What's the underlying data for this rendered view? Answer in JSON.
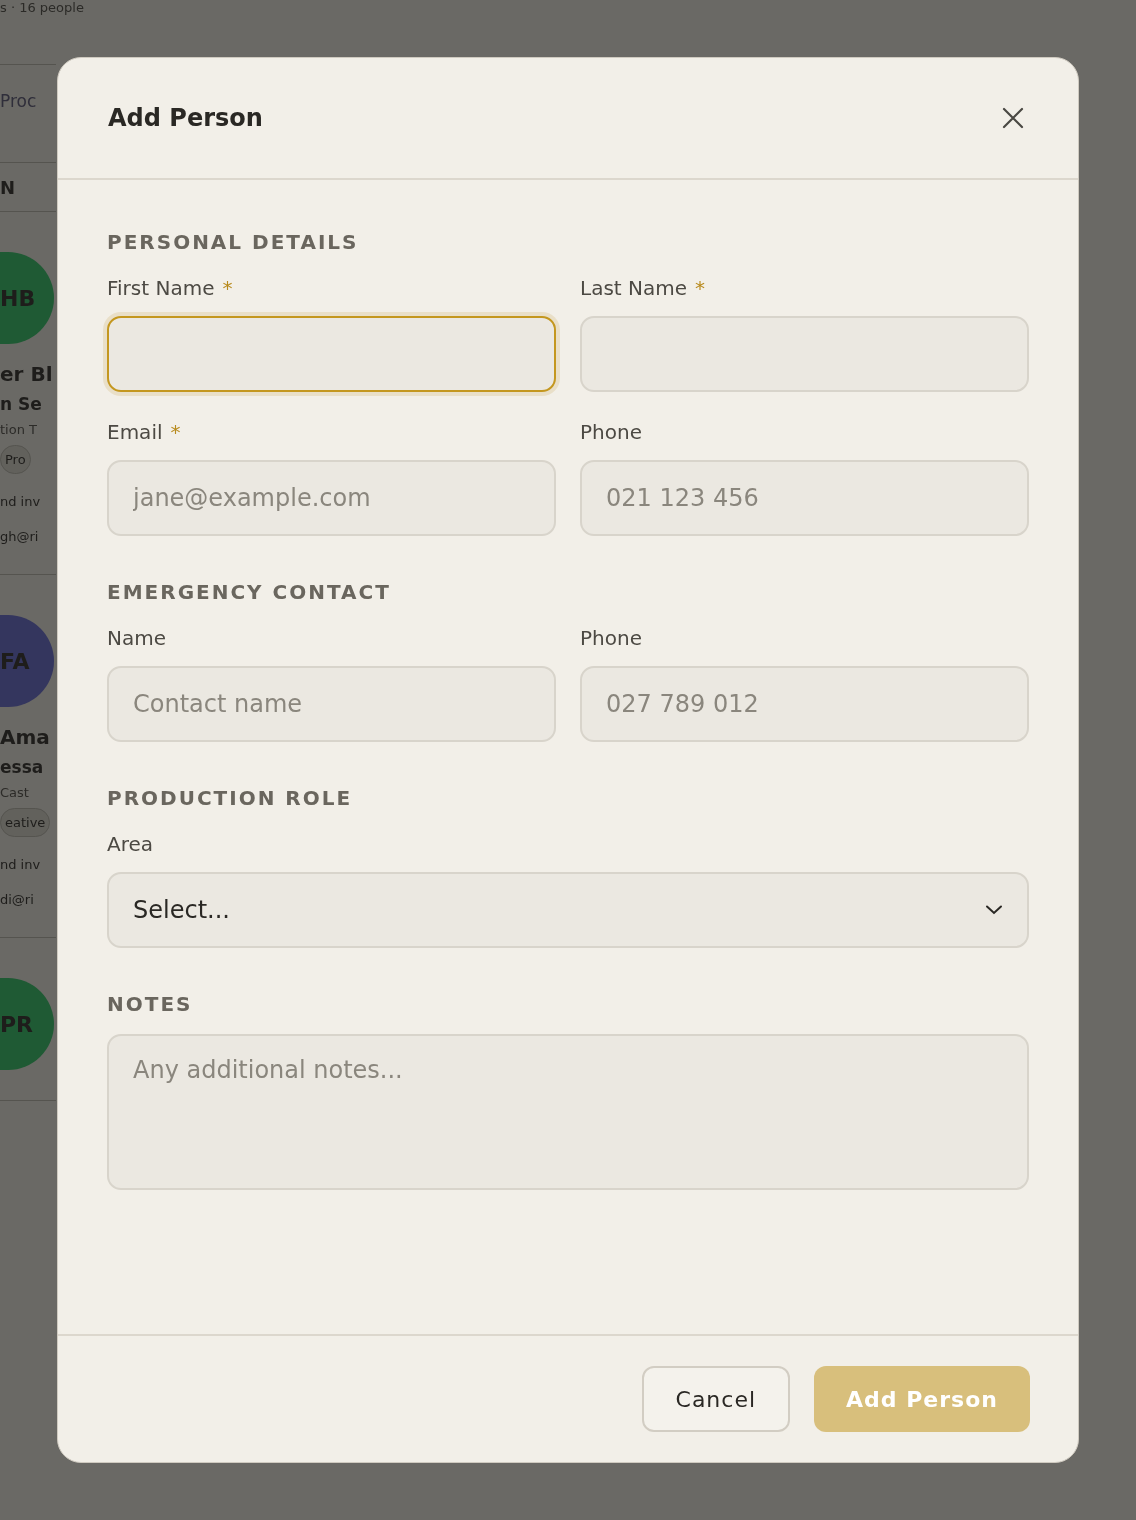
{
  "background": {
    "header_text": "s · 16 people",
    "tab_text": "Proc",
    "column_text": "N",
    "cards": [
      {
        "initials": "HB",
        "color": "#1f5a34",
        "name": "er Bl",
        "role": "n Se",
        "team": "tion T",
        "tag": "Pro",
        "status": "nd inv",
        "email": "gh@ri"
      },
      {
        "initials": "FA",
        "color": "#34365e",
        "name": "Ama",
        "role": "essa",
        "team": "Cast",
        "tag": "eative",
        "status": "nd inv",
        "email": "di@ri"
      },
      {
        "initials": "PR",
        "color": "#1f5a34"
      }
    ]
  },
  "dialog": {
    "title": "Add Person",
    "sections": [
      {
        "heading": "PERSONAL DETAILS",
        "fields": [
          {
            "kind": "text",
            "label": "First Name",
            "required_mark": "*",
            "focused": true
          },
          {
            "kind": "text",
            "label": "Last Name",
            "required_mark": "*",
            "focused": false
          },
          {
            "kind": "text",
            "label": "Email",
            "required_mark": "*",
            "focused": false,
            "placeholder": "jane@example.com"
          },
          {
            "kind": "text",
            "label": "Phone",
            "focused": false,
            "placeholder": "021 123 456"
          }
        ]
      },
      {
        "heading": "EMERGENCY CONTACT",
        "fields": [
          {
            "kind": "text",
            "label": "Name",
            "focused": false,
            "placeholder": "Contact name"
          },
          {
            "kind": "text",
            "label": "Phone",
            "focused": false,
            "placeholder": "027 789 012"
          }
        ]
      },
      {
        "heading": "PRODUCTION ROLE",
        "fields": [
          {
            "kind": "select",
            "label": "Area",
            "focused": false,
            "value": "Select..."
          }
        ]
      },
      {
        "heading": "NOTES",
        "fields": [
          {
            "kind": "textarea",
            "focused": false,
            "placeholder": "Any additional notes..."
          }
        ]
      }
    ],
    "buttons": [
      {
        "label": "Cancel",
        "kind": "secondary"
      },
      {
        "label": "Add Person",
        "kind": "primary",
        "disabled": true
      }
    ]
  }
}
